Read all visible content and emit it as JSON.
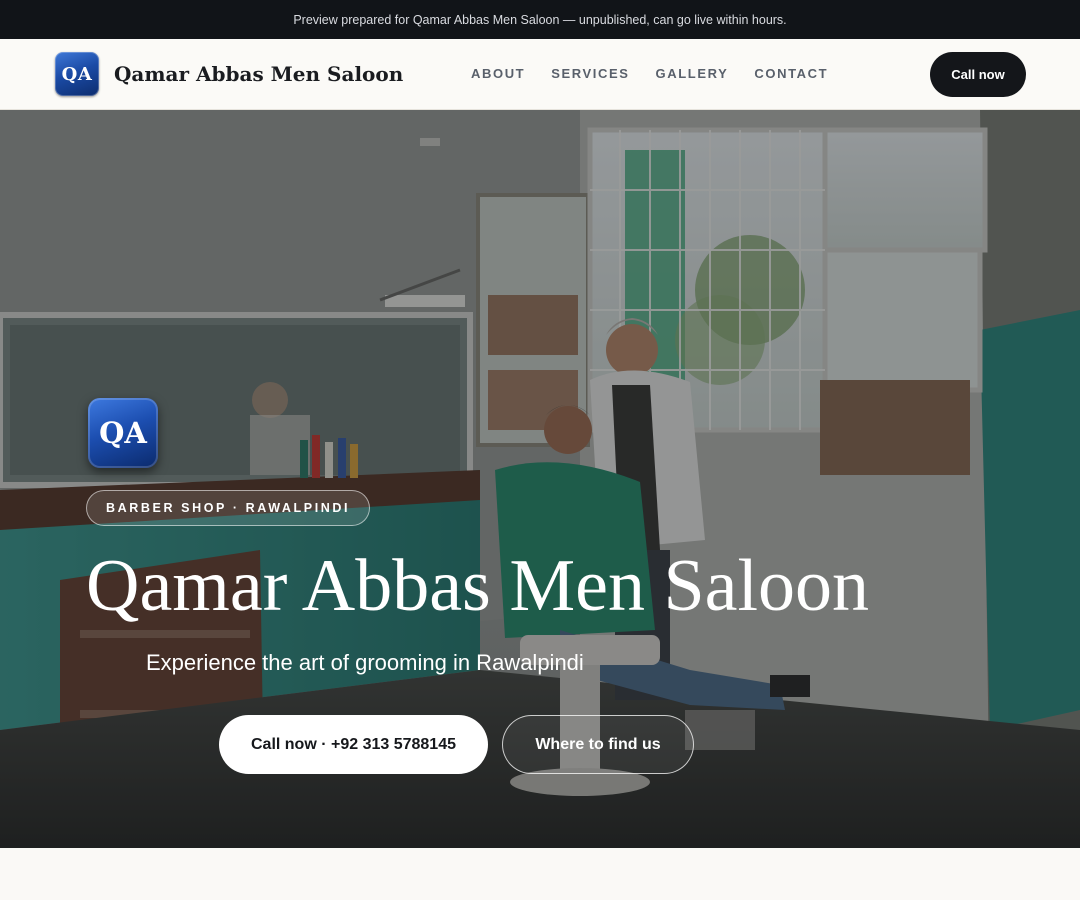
{
  "preview_banner": "Preview prepared for Qamar Abbas Men Saloon — unpublished, can go live within hours.",
  "brand": {
    "logo_text": "QA",
    "name": "Qamar Abbas Men Saloon",
    "logo_colors": [
      "#3f79d8",
      "#1b4ba6",
      "#0d2d6e"
    ]
  },
  "nav": {
    "links": [
      "ABOUT",
      "SERVICES",
      "GALLERY",
      "CONTACT"
    ],
    "cta": "Call now"
  },
  "hero": {
    "logo_text": "QA",
    "tag": "BARBER SHOP · RAWALPINDI",
    "title": "Qamar Abbas Men Saloon",
    "subtitle": "Experience the art of grooming in Rawalpindi",
    "primary_button": "Call now · +92 313 5788145",
    "secondary_button": "Where to find us"
  },
  "colors": {
    "dark": "#111418",
    "accent_blue": "#1b4ba6",
    "teal_wall": "#2f8a80"
  }
}
